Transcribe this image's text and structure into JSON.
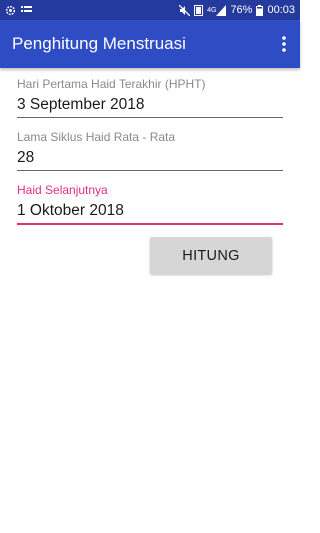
{
  "status_bar": {
    "network": "4G",
    "battery": "76%",
    "time": "00:03",
    "icons": [
      "settings-cog-icon",
      "list-icon",
      "mute-icon",
      "data-icon",
      "signal-icon",
      "battery-icon"
    ]
  },
  "app_bar": {
    "title": "Penghitung Menstruasi",
    "menu_icon": "overflow-menu-icon"
  },
  "form": {
    "hpht_label": "Hari Pertama Haid Terakhir (HPHT)",
    "hpht_value": "3 September 2018",
    "cycle_label": "Lama Siklus Haid Rata - Rata",
    "cycle_value": "28",
    "next_label": "Haid Selanjutnya",
    "next_value": "1 Oktober 2018"
  },
  "button": {
    "label": "HITUNG"
  },
  "colors": {
    "status_bar": "#243a9c",
    "app_bar": "#2e4cc4",
    "accent": "#e0307e"
  }
}
